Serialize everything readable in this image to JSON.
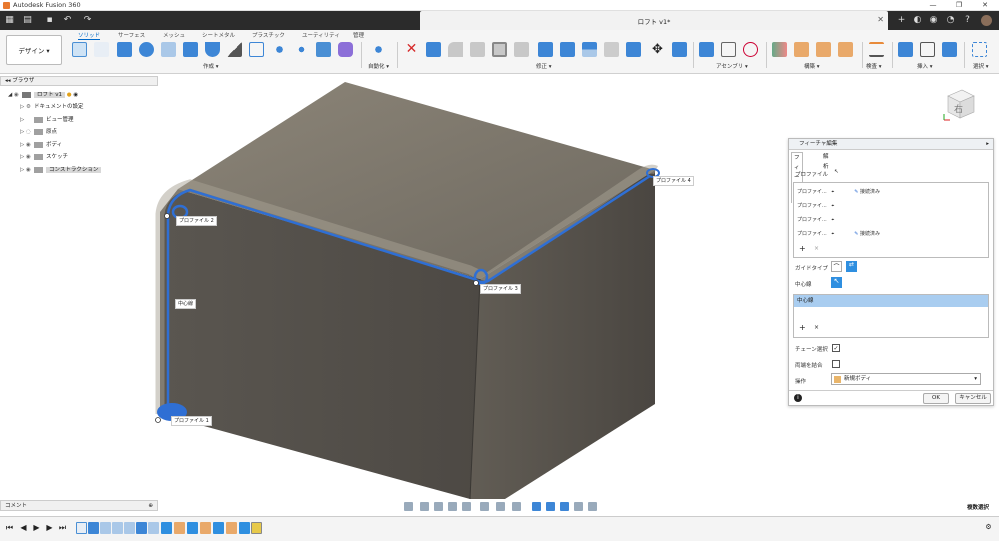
{
  "titlebar": {
    "app_title": "Autodesk Fusion 360",
    "min": "—",
    "max": "❐",
    "close": "✕"
  },
  "doc_tab": {
    "label": "ロフト v1*",
    "close": "✕"
  },
  "workspace": {
    "label": "デザイン ▾"
  },
  "toolbar": {
    "tabs": [
      "ソリッド",
      "サーフェス",
      "メッシュ",
      "シートメタル",
      "プラスチック",
      "ユーティリティ",
      "管理"
    ],
    "groups": [
      "作成 ▾",
      "自動化 ▾",
      "修正 ▾",
      "アセンブリ ▾",
      "構築 ▾",
      "検査 ▾",
      "挿入 ▾",
      "選択 ▾"
    ]
  },
  "browser": {
    "title": "ブラウザ",
    "root": "ロフト v1",
    "items": [
      "ドキュメントの設定",
      "ビュー管理",
      "原点",
      "ボディ",
      "スケッチ",
      "コンストラクション"
    ]
  },
  "viewport": {
    "labels": {
      "p1": "プロファイル 1",
      "p2": "プロファイル 2",
      "p3": "プロファイル 3",
      "p4": "プロファイル 4",
      "centerline": "中心線"
    },
    "viewcube": "右"
  },
  "feature_panel": {
    "title": "フィーチャ編集",
    "tabs": [
      "フィーチャ",
      "解析"
    ],
    "profile_label": "プロファイル",
    "profiles": [
      {
        "name": "プロファイ...",
        "status": "接続済み"
      },
      {
        "name": "プロファイ...",
        "status": ""
      },
      {
        "name": "プロファイ...",
        "status": ""
      },
      {
        "name": "プロファイ...",
        "status": "接続済み"
      }
    ],
    "guide_type_label": "ガイドタイプ",
    "centerline_label": "中心線",
    "centerline_item": "中心線",
    "chain_select_label": "チェーン選択",
    "merge_ends_label": "両端を結合",
    "operation_label": "操作",
    "operation_value": "新規ボディ",
    "ok": "OK",
    "cancel": "キャンセル",
    "add": "+",
    "remove": "×",
    "info": "i"
  },
  "comment": {
    "label": "コメント"
  },
  "component": {
    "label": "複数選択"
  },
  "colors": {
    "accent": "#0068c8",
    "body": "#5c5850",
    "selection": "#2f6fd4"
  }
}
